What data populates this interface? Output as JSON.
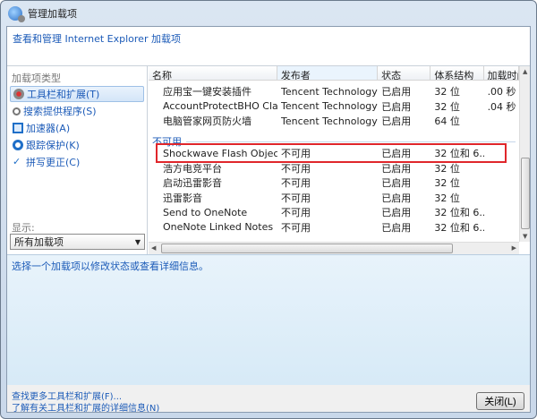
{
  "window": {
    "title": "管理加载项"
  },
  "header": {
    "link": "查看和管理 Internet Explorer 加载项"
  },
  "sidebar": {
    "caption": "加载项类型",
    "items": [
      {
        "label": "工具栏和扩展(T)",
        "icon": "gear-icon",
        "selected": true
      },
      {
        "label": "搜索提供程序(S)",
        "icon": "search-icon"
      },
      {
        "label": "加速器(A)",
        "icon": "accelerator-icon"
      },
      {
        "label": "跟踪保护(K)",
        "icon": "block-icon"
      },
      {
        "label": "拼写更正(C)",
        "icon": "spellcheck-icon"
      }
    ],
    "show_caption": "显示:",
    "show_value": "所有加载项"
  },
  "table": {
    "columns": [
      "名称",
      "发布者",
      "状态",
      "体系结构",
      "加载时间"
    ],
    "rows": [
      [
        "应用宝一键安装插件",
        "Tencent Technology(S...",
        "已启用",
        "32 位",
        ".00 秒"
      ],
      [
        "AccountProtectBHO Class",
        "Tencent Technology(S...",
        "已启用",
        "32 位",
        ".04 秒"
      ],
      [
        "电脑管家网页防火墙",
        "Tencent Technology(S...",
        "已启用",
        "64 位",
        ""
      ]
    ],
    "group_label": "不可用",
    "group_rows": [
      [
        "Shockwave Flash Object",
        "不可用",
        "已启用",
        "32 位和 6...",
        ""
      ],
      [
        "浩方电竞平台",
        "不可用",
        "已启用",
        "32 位",
        ""
      ],
      [
        "启动迅雷影音",
        "不可用",
        "已启用",
        "32 位",
        ""
      ],
      [
        "迅雷影音",
        "不可用",
        "已启用",
        "32 位",
        ""
      ],
      [
        "Send to OneNote",
        "不可用",
        "已启用",
        "32 位和 6...",
        ""
      ],
      [
        "OneNote Linked Notes",
        "不可用",
        "已启用",
        "32 位和 6...",
        ""
      ]
    ]
  },
  "details": {
    "hint": "选择一个加载项以修改状态或查看详细信息。"
  },
  "footer": {
    "link1": "查找更多工具栏和扩展(F)...",
    "link2": "了解有关工具栏和扩展的详细信息(N)",
    "close": "关闭(L)"
  },
  "colors": {
    "link": "#1c5bb8",
    "highlight": "#e0262b"
  }
}
